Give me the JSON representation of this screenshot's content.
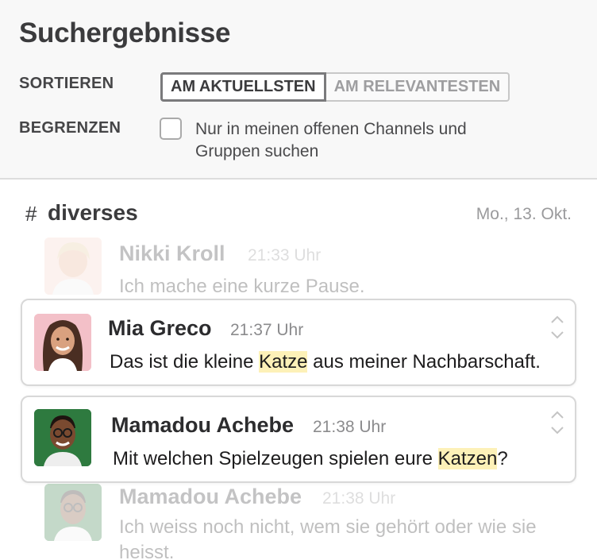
{
  "header": {
    "title": "Suchergebnisse",
    "sort_label": "SORTIEREN",
    "sort_options": [
      "AM AKTUELLSTEN",
      "AM RELEVANTESTEN"
    ],
    "limit_label": "BEGRENZEN",
    "limit_checkbox_label": "Nur in meinen offenen Channels und Gruppen suchen",
    "limit_checked": false
  },
  "channel": {
    "hash": "#",
    "name": "diverses",
    "date": "Mo., 13. Okt."
  },
  "messages": [
    {
      "sender": "Nikki Kroll",
      "time": "21:33 Uhr",
      "text": "Ich mache eine kurze Pause.",
      "state": "context"
    },
    {
      "sender": "Mia Greco",
      "time": "21:37 Uhr",
      "text_before": "Das ist die kleine ",
      "highlight": "Katze",
      "text_after": " aus meiner Nachbarschaft.",
      "state": "result"
    },
    {
      "sender": "Mamadou Achebe",
      "time": "21:38 Uhr",
      "text_before": "Mit welchen Spielzeugen spielen eure ",
      "highlight": "Katzen",
      "text_after": "?",
      "state": "result"
    },
    {
      "sender": "Mamadou Achebe",
      "time": "21:38 Uhr",
      "text": "Ich weiss noch nicht, wem sie gehört oder wie sie heisst.",
      "state": "context"
    }
  ],
  "colors": {
    "highlight": "#fdf1b8",
    "header_bg": "#f8f8f8",
    "card_border": "#d8d8d8"
  },
  "icons": [
    "expand-chevrons-icon"
  ]
}
